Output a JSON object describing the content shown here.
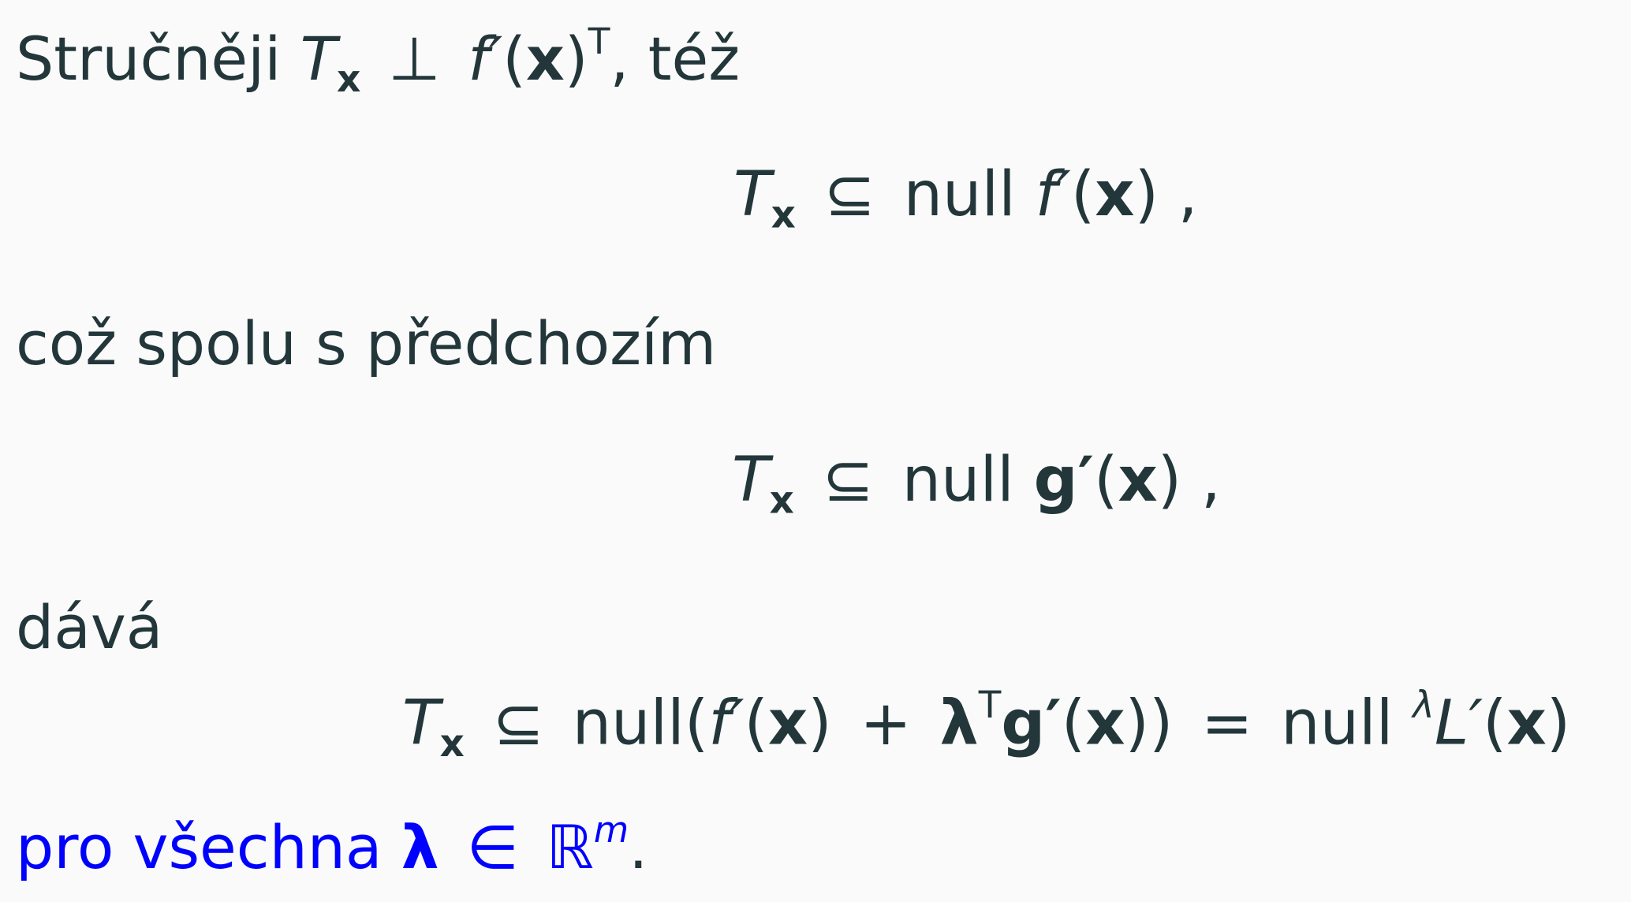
{
  "lines": {
    "intro_prefix": "Stručněji",
    "intro_suffix": ", též",
    "mid_text": "což spolu s předchozím",
    "gives_text": "dává",
    "final_prefix": "pro všechna"
  },
  "symbols": {
    "T": "T",
    "x_sub": "x",
    "perp": "⊥",
    "f_prime": "f′",
    "lparen": "(",
    "rparen": ")",
    "x": "x",
    "transpose": "T",
    "subseteq": "⊆",
    "null": "null",
    "comma": ",",
    "g_prime": "g′",
    "plus": "+",
    "lambda": "λ",
    "equals": "=",
    "L_prime": "L′",
    "double_rparen": "))",
    "in": "∈",
    "reals": "ℝ",
    "m": "m",
    "period": "."
  },
  "colors": {
    "text": "#23373b",
    "emphasis": "#0000ff",
    "background": "#fafafa"
  }
}
